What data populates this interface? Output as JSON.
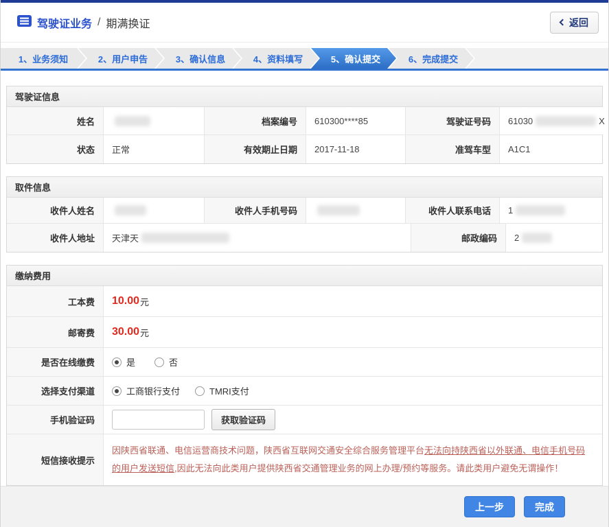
{
  "colors": {
    "accent_navy": "#1e3c96",
    "step_active_blue": "#2d6ec6",
    "steps_underline": "#3173ce",
    "fee_red": "#e02a1f",
    "notice_red": "#bb6159",
    "button_blue": "#4286e5",
    "link_blue": "#2b52cc"
  },
  "icons": {
    "breadcrumb": "document-list-icon",
    "back": "chevron-left-icon"
  },
  "header": {
    "section": "驾驶证业务",
    "separator": "/",
    "current": "期满换证",
    "back_label": "返回"
  },
  "steps": [
    {
      "label": "1、业务须知",
      "active": false
    },
    {
      "label": "2、用户申告",
      "active": false
    },
    {
      "label": "3、确认信息",
      "active": false
    },
    {
      "label": "4、资料填写",
      "active": false
    },
    {
      "label": "5、确认提交",
      "active": true
    },
    {
      "label": "6、完成提交",
      "active": false
    }
  ],
  "license": {
    "title": "驾驶证信息",
    "name_label": "姓名",
    "name_value": "",
    "name_redacted": true,
    "file_no_label": "档案编号",
    "file_no_value": "610300****85",
    "license_no_label": "驾驶证号码",
    "license_no_prefix": "61030",
    "license_no_suffix": "X",
    "license_no_redacted": true,
    "status_label": "状态",
    "status_value": "正常",
    "expiry_label": "有效期止日期",
    "expiry_value": "2017-11-18",
    "vehicle_label": "准驾车型",
    "vehicle_value": "A1C1"
  },
  "pickup": {
    "title": "取件信息",
    "recipient_name_label": "收件人姓名",
    "recipient_name_redacted": true,
    "mobile_label": "收件人手机号码",
    "mobile_redacted": true,
    "phone_label": "收件人联系电话",
    "phone_prefix": "1",
    "phone_redacted": true,
    "address_label": "收件人地址",
    "address_prefix": "天津天",
    "address_redacted": true,
    "postal_label": "邮政编码",
    "postal_prefix": "2",
    "postal_redacted": true
  },
  "fees": {
    "title": "缴纳费用",
    "production_fee_label": "工本费",
    "production_fee_amount": "10.00",
    "postage_fee_label": "邮寄费",
    "postage_fee_amount": "30.00",
    "fee_unit": "元",
    "online_pay_label": "是否在线缴费",
    "online_yes": "是",
    "online_no": "否",
    "online_selected": "是",
    "channel_label": "选择支付渠道",
    "channel_icbc": "工商银行支付",
    "channel_tmri": "TMRI支付",
    "channel_selected": "工商银行支付",
    "sms_code_label": "手机验证码",
    "sms_code_value": "",
    "get_code_button": "获取验证码",
    "notice_label": "短信接收提示",
    "notice_part1": "因陕西省联通、电信运营商技术问题，陕西省互联网交通安全综合服务管理平台",
    "notice_underlined": "无法向持陕西省以外联通、电信手机号码的用户发送短信",
    "notice_part2": ",因此无法向此类用户提供陕西省交通管理业务的网上办理/预约等服务。请此类用户避免无谓操作！"
  },
  "footer": {
    "prev_button": "上一步",
    "done_button": "完成"
  }
}
